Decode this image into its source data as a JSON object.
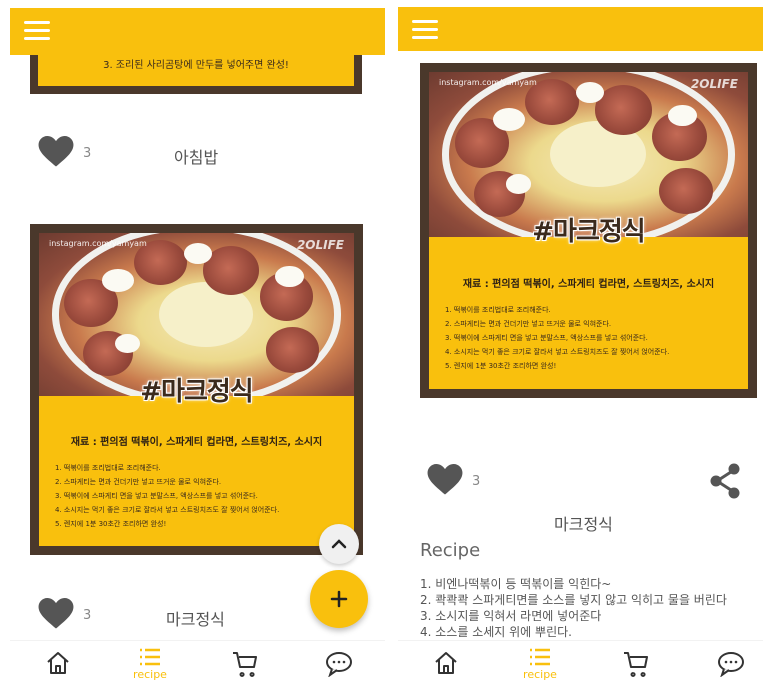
{
  "colors": {
    "accent": "#F9C00D",
    "card_frame": "#4a382b",
    "heart": "#555555"
  },
  "left_screen": {
    "top_peek_text": "3. 조리된 사리곰탕에 만두를 넣어주면 완성!",
    "post1": {
      "likes": "3",
      "title": "아침밥"
    },
    "card": {
      "watermark": "instagram.com/yamyam",
      "brand": "2OLIFE",
      "title": "#마크정식",
      "ingredients": "재료 : 편의점 떡볶이, 스파게티 컵라면, 스트링치즈, 소시지",
      "steps": [
        "1. 떡볶이를 조리법대로 조리해준다.",
        "2. 스파게티는 면과 건더기만 넣고 뜨거운 물로 익혀준다.",
        "3. 떡볶이에 스파게티 면을 넣고 분말스프, 액상스프를 넣고 섞어준다.",
        "4. 소시지는 먹기 좋은 크기로 잘라서 넣고 스트링치즈도 잘 찢어서 얹어준다.",
        "5. 렌지에 1분 30초간 조리하면 완성!"
      ]
    },
    "post2": {
      "likes": "3",
      "title": "마크정식"
    }
  },
  "right_screen": {
    "card": {
      "watermark": "instagram.com/yamyam",
      "brand": "2OLIFE",
      "title": "#마크정식",
      "ingredients": "재료 : 편의점 떡볶이, 스파게티 컵라면, 스트링치즈, 소시지",
      "steps": [
        "1. 떡볶이를 조리법대로 조리해준다.",
        "2. 스파게티는 면과 건더기만 넣고 뜨거운 물로 익혀준다.",
        "3. 떡볶이에 스파게티 면을 넣고 분말스프, 액상스프를 넣고 섞어준다.",
        "4. 소시지는 먹기 좋은 크기로 잘라서 넣고 스트링치즈도 잘 찢어서 얹어준다.",
        "5. 렌지에 1분 30초간 조리하면 완성!"
      ]
    },
    "likes": "3",
    "title": "마크정식",
    "recipe_heading": "Recipe",
    "recipe_steps": [
      "1. 비엔나떡볶이 등 떡볶이를 익힌다~",
      "2. 콱콱콱 스파게티면를 소스를 넣지 않고 익히고 물을 버린다",
      "3. 소시지를 익혀서 라면에 넣어준다",
      "4. 소스를 소세지 위에 뿌린다."
    ]
  },
  "bottom_nav": {
    "recipe_label": "recipe"
  }
}
